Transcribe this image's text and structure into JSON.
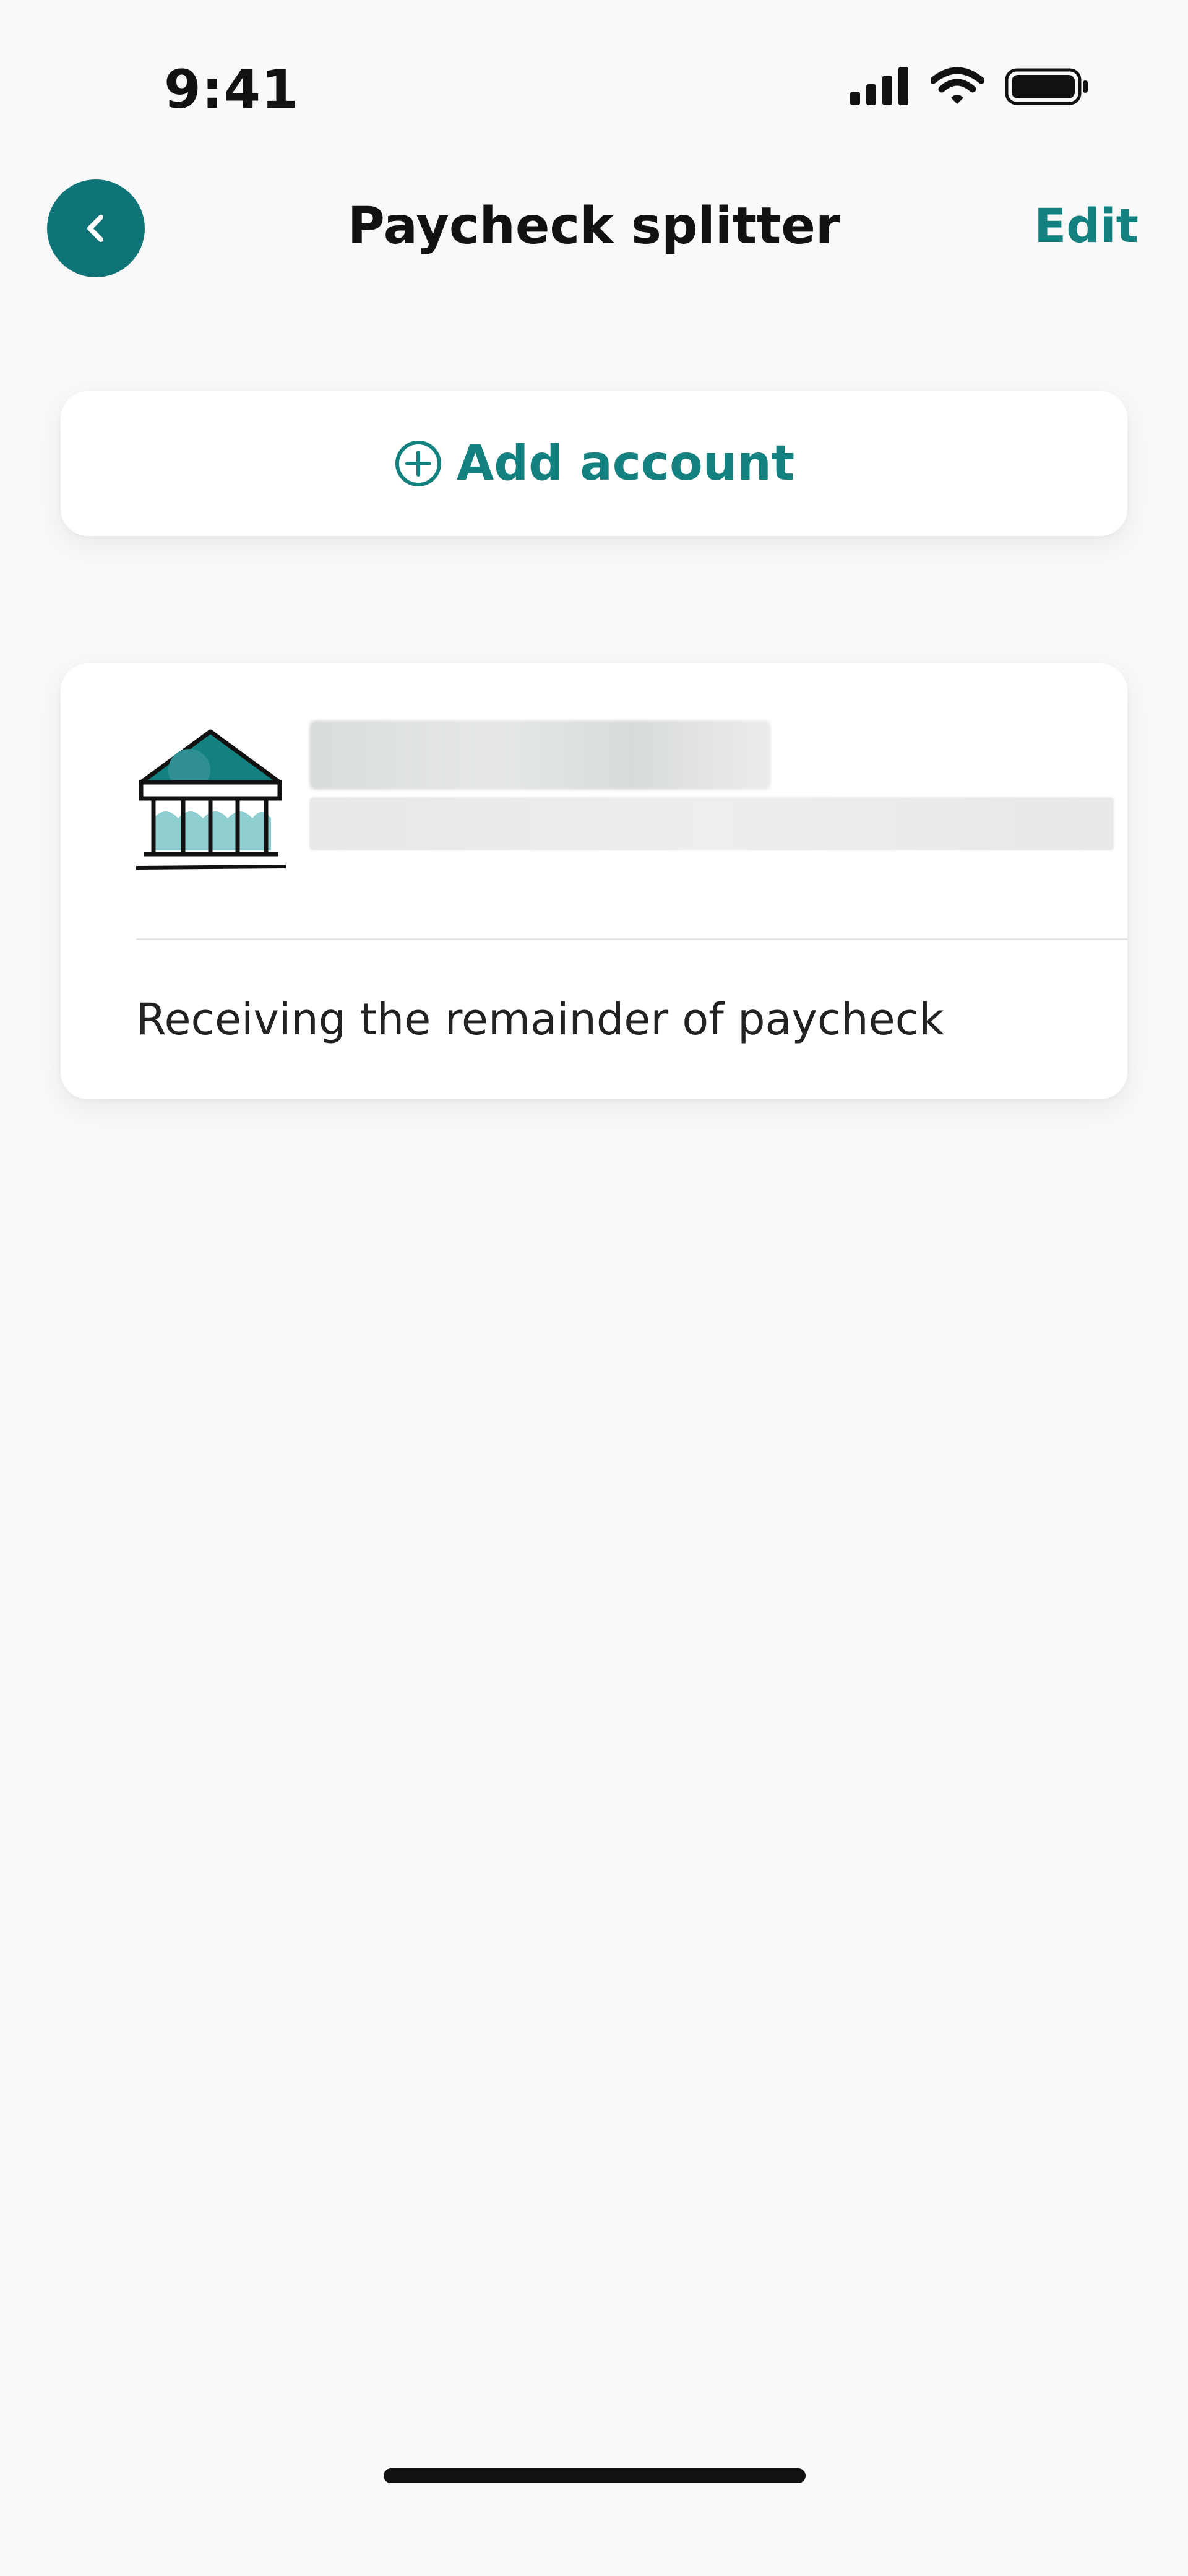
{
  "status_bar": {
    "time": "9:41",
    "icons": [
      "signal-icon",
      "wifi-icon",
      "battery-icon"
    ]
  },
  "header": {
    "back_icon": "chevron-left-icon",
    "title": "Paycheck splitter",
    "edit_label": "Edit"
  },
  "add_account": {
    "icon": "plus-circle-icon",
    "label": "Add account"
  },
  "accounts": [
    {
      "icon": "bank-icon",
      "status_text": "Receiving the remainder of paycheck"
    }
  ],
  "colors": {
    "accent": "#13817f",
    "back_button": "#0f7478",
    "background": "#f9f9f9",
    "card": "#ffffff",
    "bank_light": "#8fcfd1"
  }
}
